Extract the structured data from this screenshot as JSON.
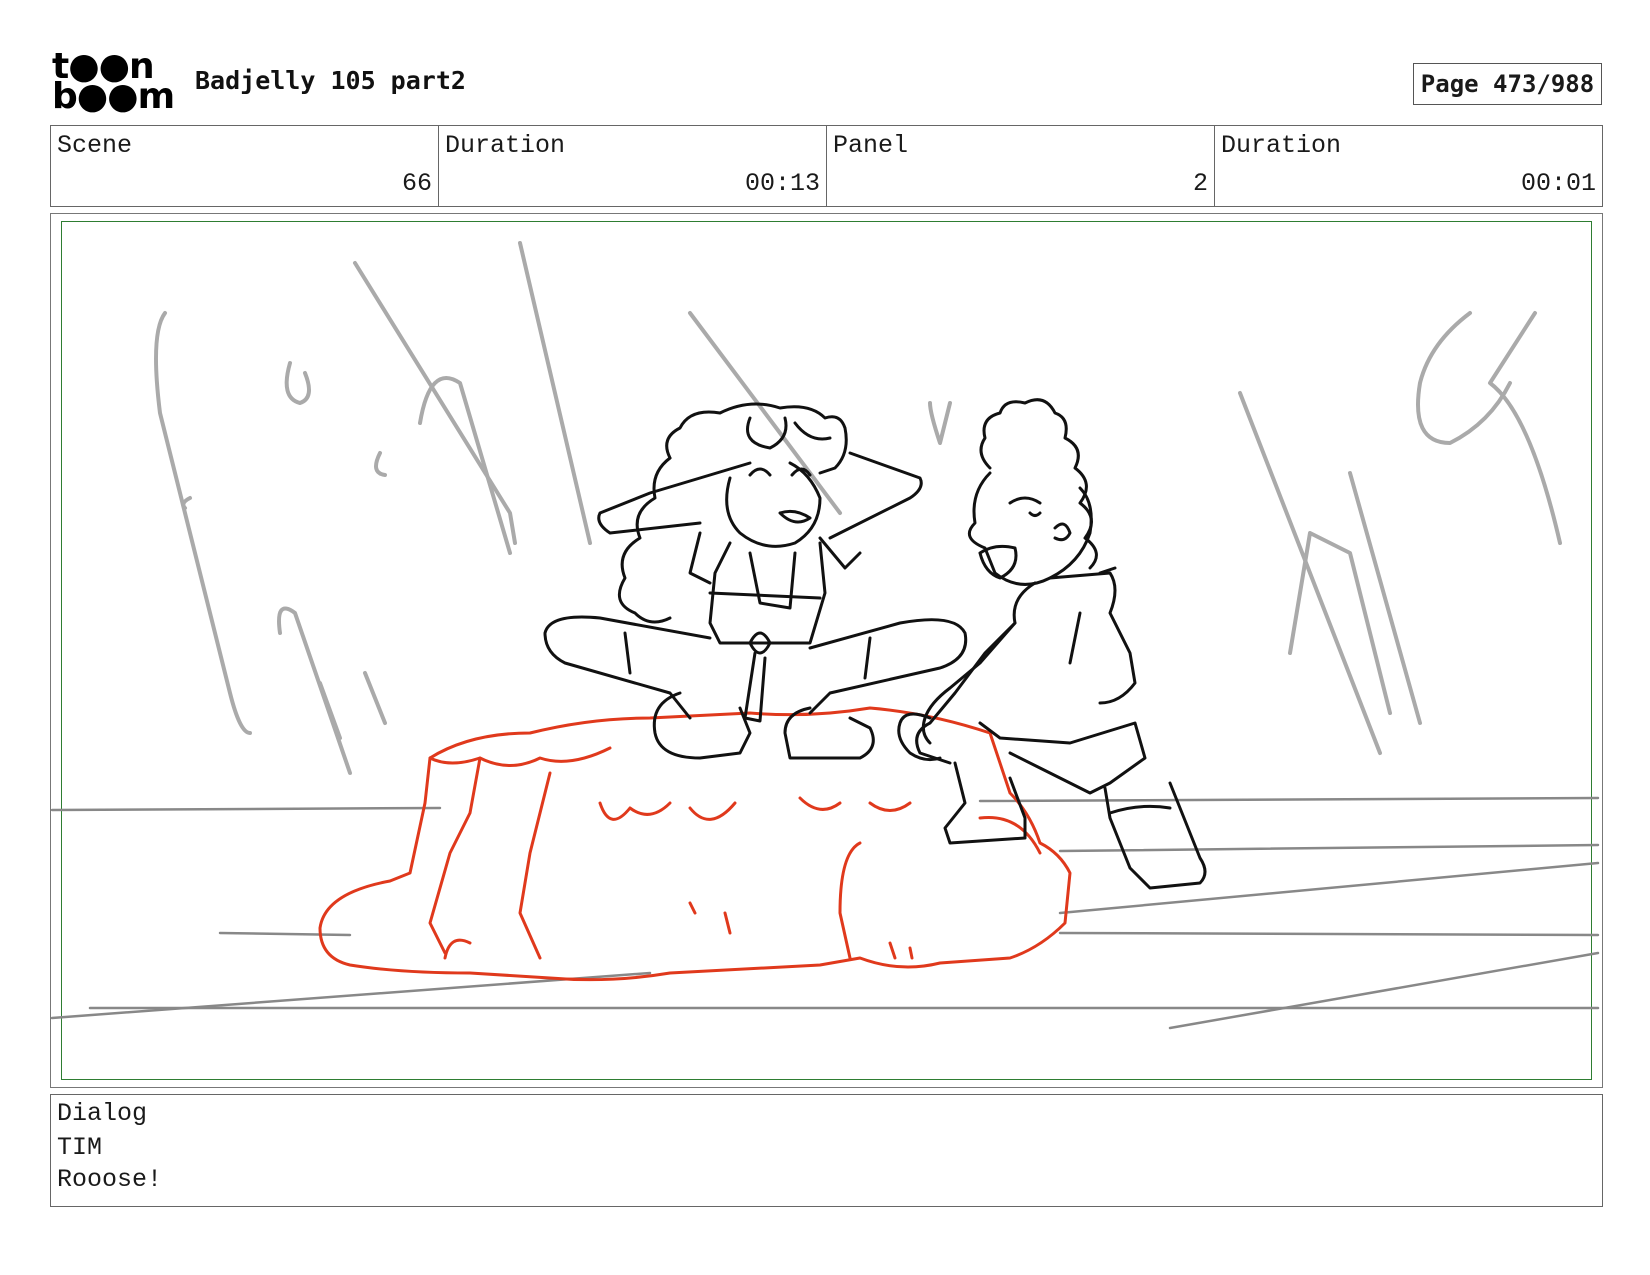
{
  "header": {
    "logo_line1": "t●●n",
    "logo_line2": "b●●m",
    "title": "Badjelly 105 part2",
    "page": "Page 473/988"
  },
  "info": {
    "scene_label": "Scene",
    "scene_value": "66",
    "scene_duration_label": "Duration",
    "scene_duration_value": "00:13",
    "panel_label": "Panel",
    "panel_value": "2",
    "panel_duration_label": "Duration",
    "panel_duration_value": "00:01"
  },
  "dialog": {
    "label": "Dialog",
    "speaker": "TIM",
    "line": "Rooose!"
  },
  "colors": {
    "frame_border": "#2e7d32",
    "rock_stroke": "#e0391c",
    "character_stroke": "#111111",
    "background_stroke": "#aaaaaa"
  }
}
